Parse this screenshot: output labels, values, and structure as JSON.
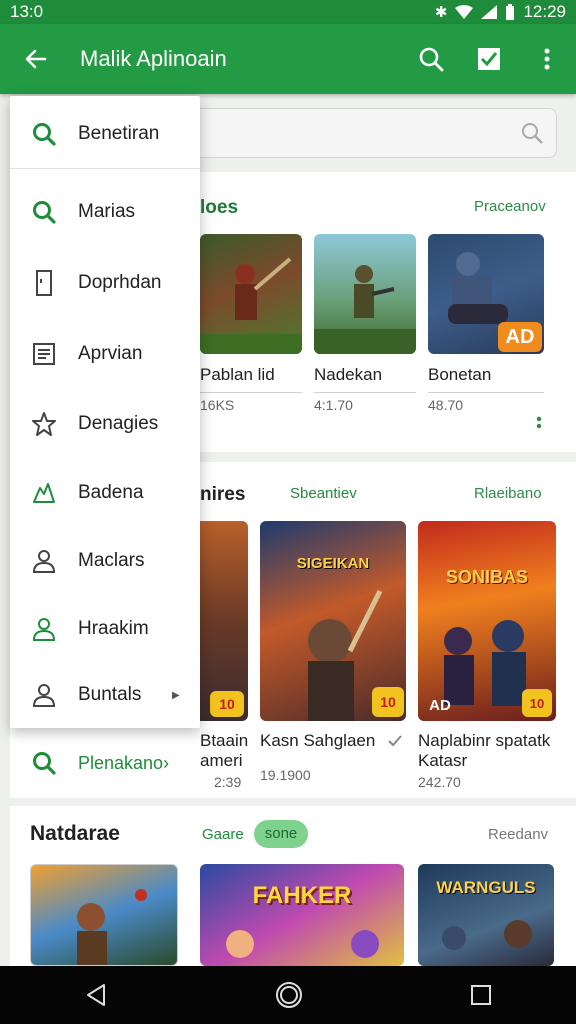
{
  "status_bar": {
    "time": "13:0",
    "clock": "12:29"
  },
  "app_bar": {
    "title": "Malik Aplinoain"
  },
  "drawer": {
    "items": [
      {
        "label": "Benetiran",
        "icon": "search-icon"
      },
      {
        "label": "Marias",
        "icon": "search-icon"
      },
      {
        "label": "Doprhdan",
        "icon": "phone-icon"
      },
      {
        "label": "Aprvian",
        "icon": "document-icon"
      },
      {
        "label": "Denagies",
        "icon": "star-icon"
      },
      {
        "label": "Badena",
        "icon": "gamepad-icon"
      },
      {
        "label": "Maclars",
        "icon": "person-icon"
      },
      {
        "label": "Hraakim",
        "icon": "person-icon"
      },
      {
        "label": "Buntals",
        "icon": "person-icon"
      }
    ],
    "footer_link": "Plenakano"
  },
  "section1": {
    "title": "loes",
    "link": "Praceanov",
    "cards": [
      {
        "name": "Pablan lid",
        "meta": "16KS"
      },
      {
        "name": "Nadekan",
        "meta": "4:1.70"
      },
      {
        "name": "Bonetan",
        "meta": "48.70",
        "badge": "AD"
      }
    ]
  },
  "section2": {
    "title": "nires",
    "subtitle": "Sbeantiev",
    "link": "Rlaeibano",
    "cards": [
      {
        "name": "Btaain",
        "name2": "ameri",
        "meta": "2:39",
        "badge": "10"
      },
      {
        "name": "Kasn Sahglaen",
        "meta": "19.1900",
        "art_title": "SIGEIKAN",
        "badge": "10"
      },
      {
        "name": "Naplabinr spatatk",
        "name2": "Katasr",
        "meta": "242.70",
        "art_title": "SONIBAS",
        "badge": "AD"
      }
    ]
  },
  "section3": {
    "title": "Natdarae",
    "subtitle": "Gaare",
    "pill": "sone",
    "link": "Reedanv",
    "cards": [
      {
        "art_title": ""
      },
      {
        "art_title": "FAHKER"
      },
      {
        "art_title": "WARNGULS"
      }
    ]
  },
  "colors": {
    "primary": "#239a44",
    "accent": "#f08c1e"
  }
}
